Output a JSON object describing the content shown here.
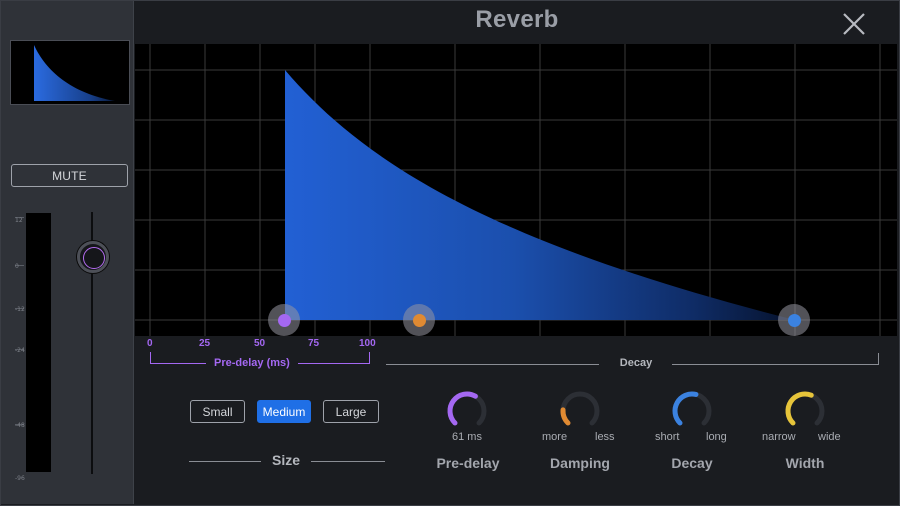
{
  "window": {
    "title": "Reverb",
    "close_icon": "close-icon"
  },
  "sidebar": {
    "mute_label": "MUTE",
    "meter_scale": [
      "12",
      "0",
      "-12",
      "-24",
      "-48",
      "-96"
    ],
    "fader_level_db": 6,
    "fader_accent": "#b46cf0"
  },
  "graph": {
    "fill_color": "#1f5fd0",
    "nodes": [
      {
        "name": "predelay-node",
        "color": "#a468f2"
      },
      {
        "name": "damping-node",
        "color": "#e08a32"
      },
      {
        "name": "decay-node",
        "color": "#3b82e0"
      }
    ]
  },
  "predelay_ruler": {
    "ticks": [
      "0",
      "25",
      "50",
      "75",
      "100"
    ],
    "label": "Pre-delay (ms)",
    "color": "#a468f2"
  },
  "decay_ruler": {
    "label": "Decay"
  },
  "size": {
    "label": "Size",
    "options": [
      "Small",
      "Medium",
      "Large"
    ],
    "selected": "Medium",
    "accent": "#1f6fe6"
  },
  "knobs": [
    {
      "id": "predelay",
      "title": "Pre-delay",
      "value_text": "61 ms",
      "left_label": "",
      "right_label": "",
      "color": "#a468f2",
      "value": 0.61
    },
    {
      "id": "damping",
      "title": "Damping",
      "value_text": "",
      "left_label": "more",
      "right_label": "less",
      "color": "#e08a32",
      "value": 0.18
    },
    {
      "id": "decay",
      "title": "Decay",
      "value_text": "",
      "left_label": "short",
      "right_label": "long",
      "color": "#3b82e0",
      "value": 0.55
    },
    {
      "id": "width",
      "title": "Width",
      "value_text": "",
      "left_label": "narrow",
      "right_label": "wide",
      "color": "#e6c43a",
      "value": 0.58
    }
  ]
}
